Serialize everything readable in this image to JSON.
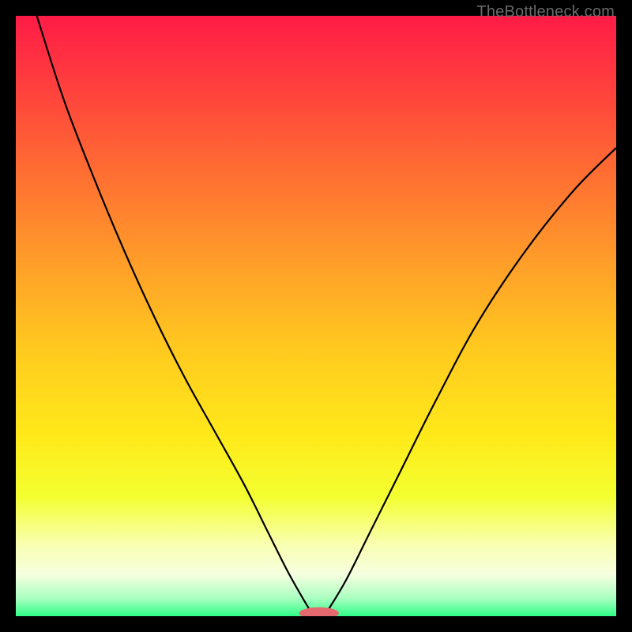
{
  "attribution": "TheBottleneck.com",
  "chart_data": {
    "type": "line",
    "title": "",
    "xlabel": "",
    "ylabel": "",
    "xlim": [
      0,
      1
    ],
    "ylim": [
      0,
      1
    ],
    "gradient_stops": [
      {
        "offset": 0.0,
        "color": "#ff1b46"
      },
      {
        "offset": 0.1,
        "color": "#ff3a3f"
      },
      {
        "offset": 0.25,
        "color": "#ff6a33"
      },
      {
        "offset": 0.4,
        "color": "#ff9a2a"
      },
      {
        "offset": 0.55,
        "color": "#ffc81f"
      },
      {
        "offset": 0.7,
        "color": "#ffe91a"
      },
      {
        "offset": 0.8,
        "color": "#f3ff2f"
      },
      {
        "offset": 0.88,
        "color": "#f9ffb0"
      },
      {
        "offset": 0.93,
        "color": "#f6ffe0"
      },
      {
        "offset": 0.97,
        "color": "#aaffc0"
      },
      {
        "offset": 1.0,
        "color": "#2fff88"
      }
    ],
    "series": [
      {
        "name": "left-curve",
        "x": [
          0.035,
          0.08,
          0.13,
          0.18,
          0.23,
          0.28,
          0.33,
          0.38,
          0.42,
          0.45,
          0.475,
          0.49
        ],
        "y": [
          1.0,
          0.86,
          0.73,
          0.61,
          0.5,
          0.4,
          0.31,
          0.22,
          0.14,
          0.08,
          0.035,
          0.01
        ]
      },
      {
        "name": "right-curve",
        "x": [
          0.52,
          0.55,
          0.59,
          0.64,
          0.7,
          0.77,
          0.85,
          0.93,
          1.0
        ],
        "y": [
          0.01,
          0.06,
          0.14,
          0.24,
          0.36,
          0.49,
          0.61,
          0.71,
          0.78
        ]
      }
    ],
    "marker": {
      "name": "minimum-marker",
      "cx": 0.505,
      "cy": 0.005,
      "rx": 0.033,
      "ry": 0.01,
      "color": "#e46a6f"
    }
  }
}
